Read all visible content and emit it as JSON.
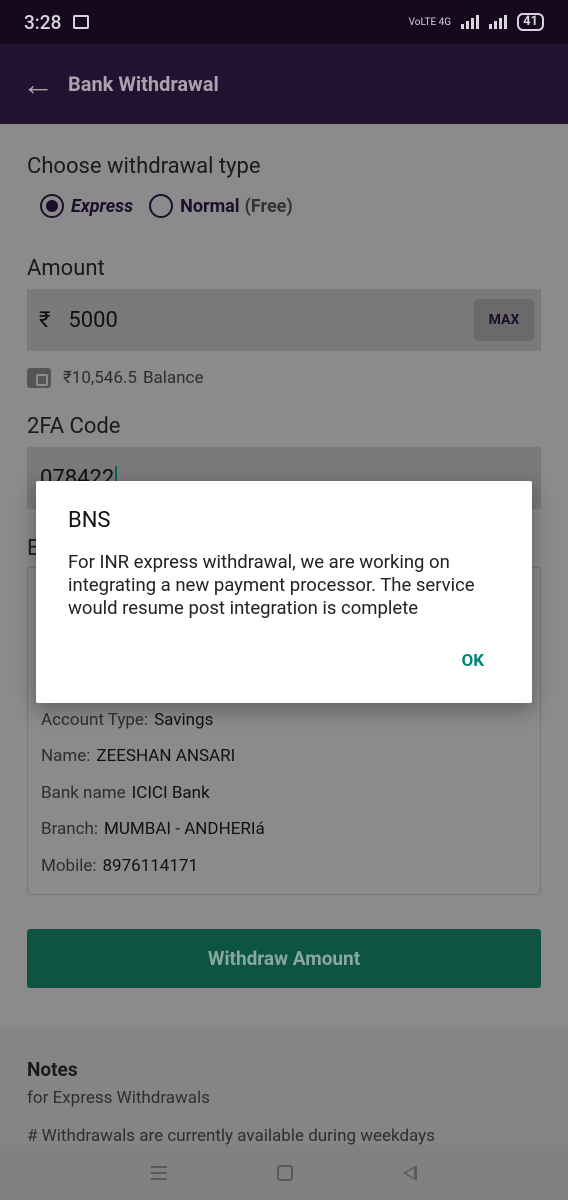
{
  "status_bar": {
    "time": "3:28",
    "network_label": "VoLTE 4G",
    "battery": "41"
  },
  "app_bar": {
    "title": "Bank Withdrawal",
    "back_icon": "arrow-left-icon"
  },
  "withdrawal_type": {
    "label": "Choose withdrawal type",
    "options": [
      {
        "label": "Express",
        "selected": true
      },
      {
        "label": "Normal",
        "suffix": "(Free)",
        "selected": false
      }
    ]
  },
  "amount": {
    "label": "Amount",
    "currency_symbol": "₹",
    "value": "5000",
    "max_label": "MAX"
  },
  "balance": {
    "value": "₹10,546.5",
    "label": "Balance"
  },
  "twofa": {
    "label": "2FA Code",
    "value": "078422"
  },
  "bank_details": {
    "heading": "B",
    "rows": [
      {
        "key": "Account Type:",
        "value": "Savings"
      },
      {
        "key": "Name:",
        "value": "ZEESHAN ANSARI"
      },
      {
        "key": "Bank name",
        "value": "ICICI Bank"
      },
      {
        "key": "Branch:",
        "value": "MUMBAI - ANDHERIá"
      },
      {
        "key": "Mobile:",
        "value": "8976114171"
      }
    ]
  },
  "withdraw_button": "Withdraw Amount",
  "notes": {
    "title": "Notes",
    "subtitle": "for Express Withdrawals",
    "line": "# Withdrawals are currently available during weekdays"
  },
  "dialog": {
    "title": "BNS",
    "message": "For INR express withdrawal, we are working on integrating a new payment processor. The service would resume post integration is complete",
    "ok_label": "OK"
  },
  "colors": {
    "accent": "#00877a",
    "app_bar": "#221131",
    "button": "#0e5443"
  }
}
